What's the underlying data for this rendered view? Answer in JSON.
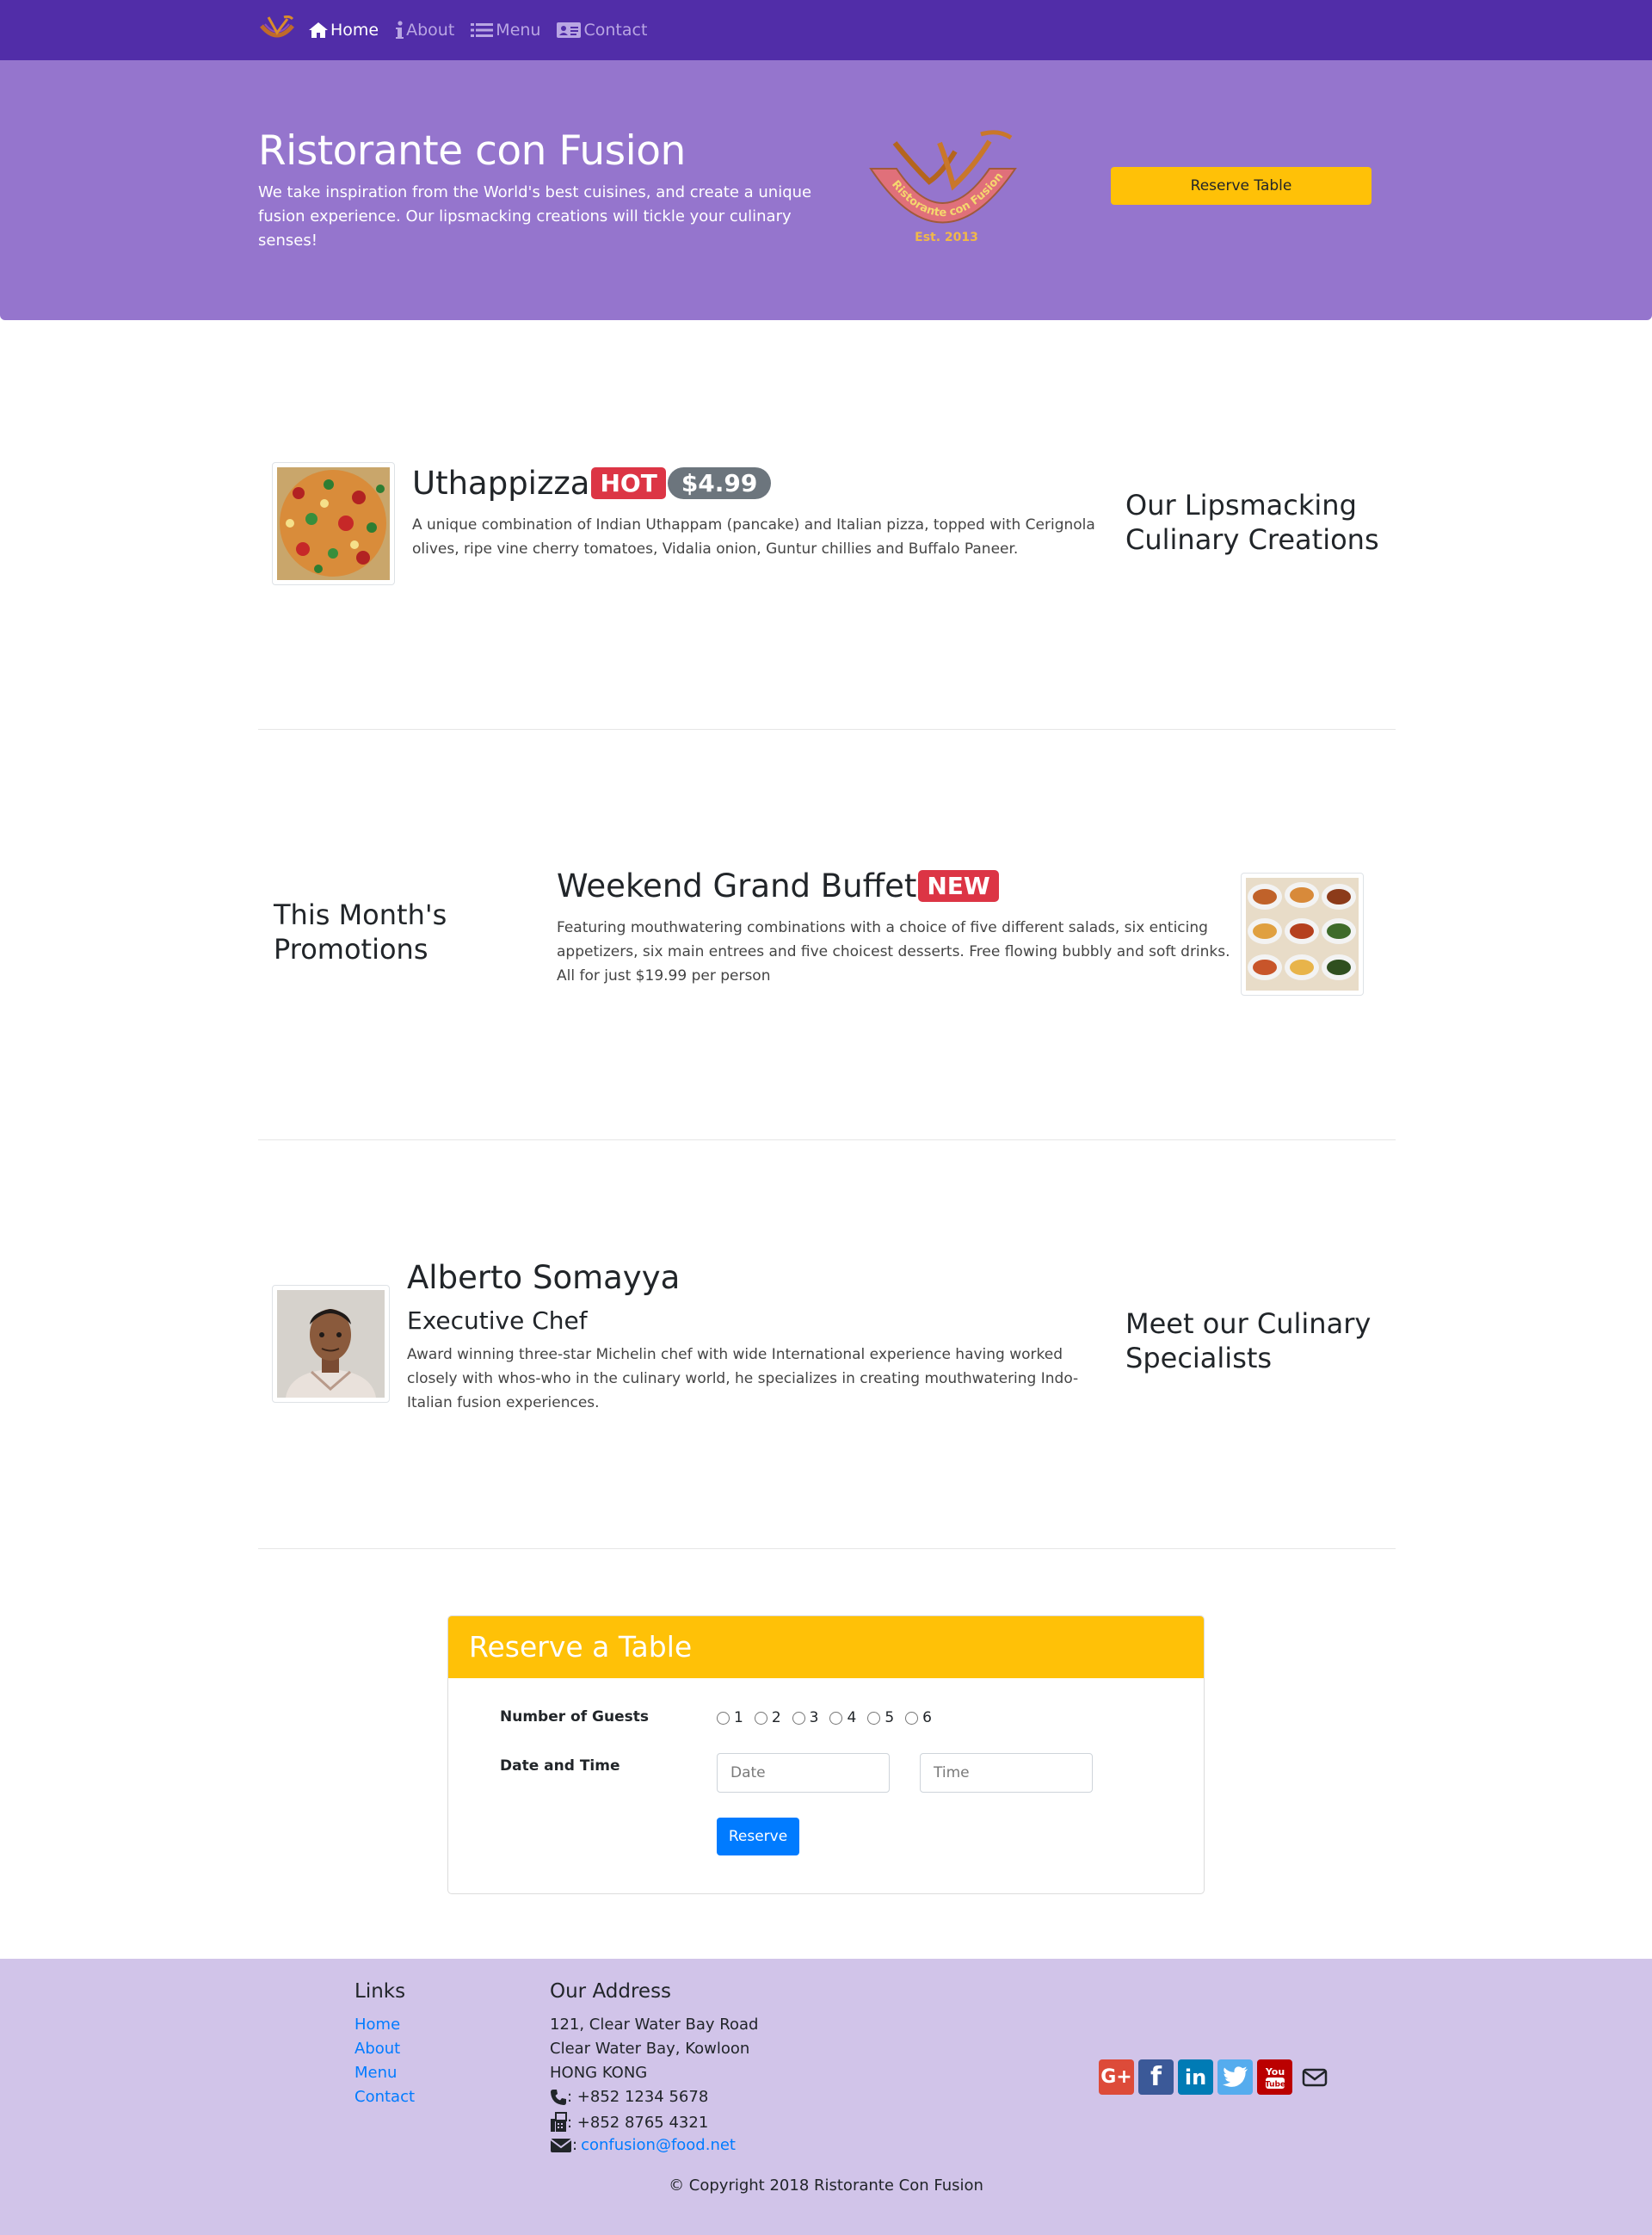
{
  "nav": {
    "items": [
      {
        "label": "Home",
        "icon": "home-icon",
        "active": true
      },
      {
        "label": "About",
        "icon": "info-icon",
        "active": false
      },
      {
        "label": "Menu",
        "icon": "list-icon",
        "active": false
      },
      {
        "label": "Contact",
        "icon": "address-card-icon",
        "active": false
      }
    ]
  },
  "jumbotron": {
    "title": "Ristorante con Fusion",
    "text": "We take inspiration from the World's best cuisines, and create a unique fusion experience. Our lipsmacking creations will tickle your culinary senses!",
    "logo_text": "Ristorante con Fusion",
    "logo_est": "Est. 2013",
    "reserve_button": "Reserve Table"
  },
  "dish": {
    "name": "Uthappizza",
    "badge": "HOT",
    "price": "$4.99",
    "description": "A unique combination of Indian Uthappam (pancake) and Italian pizza, topped with Cerignola olives, ripe vine cherry tomatoes, Vidalia onion, Guntur chillies and Buffalo Paneer.",
    "side_heading": "Our Lipsmacking Culinary Creations"
  },
  "promotion": {
    "name": "Weekend Grand Buffet",
    "badge": "NEW",
    "description": "Featuring mouthwatering combinations with a choice of five different salads, six enticing appetizers, six main entrees and five choicest desserts. Free flowing bubbly and soft drinks. All for just $19.99 per person",
    "side_heading": "This Month's Promotions"
  },
  "leader": {
    "name": "Alberto Somayya",
    "designation": "Executive Chef",
    "description": "Award winning three-star Michelin chef with wide International experience having worked closely with whos-who in the culinary world, he specializes in creating mouthwatering Indo-Italian fusion experiences.",
    "side_heading": "Meet our Culinary Specialists"
  },
  "reserve": {
    "title": "Reserve a Table",
    "guests_label": "Number of Guests",
    "guest_options": [
      "1",
      "2",
      "3",
      "4",
      "5",
      "6"
    ],
    "datetime_label": "Date and Time",
    "date_placeholder": "Date",
    "time_placeholder": "Time",
    "submit": "Reserve"
  },
  "footer": {
    "links_heading": "Links",
    "links": [
      "Home",
      "About",
      "Menu",
      "Contact"
    ],
    "address_heading": "Our Address",
    "address_lines": [
      "121, Clear Water Bay Road",
      "Clear Water Bay, Kowloon",
      "HONG KONG"
    ],
    "phone": ": +852 1234 5678",
    "fax": ": +852 8765 4321",
    "email_prefix": ":",
    "email": "confusion@food.net",
    "social": [
      "google-plus-icon",
      "facebook-icon",
      "linkedin-icon",
      "twitter-icon",
      "youtube-icon",
      "envelope-icon"
    ],
    "copyright": "© Copyright 2018 Ristorante Con Fusion"
  },
  "colors": {
    "primary_dark": "#512DA8",
    "primary": "#9575CD",
    "primary_light": "#D1C4E9",
    "accent": "#FFC107",
    "danger": "#dc3545",
    "link": "#007bff"
  }
}
